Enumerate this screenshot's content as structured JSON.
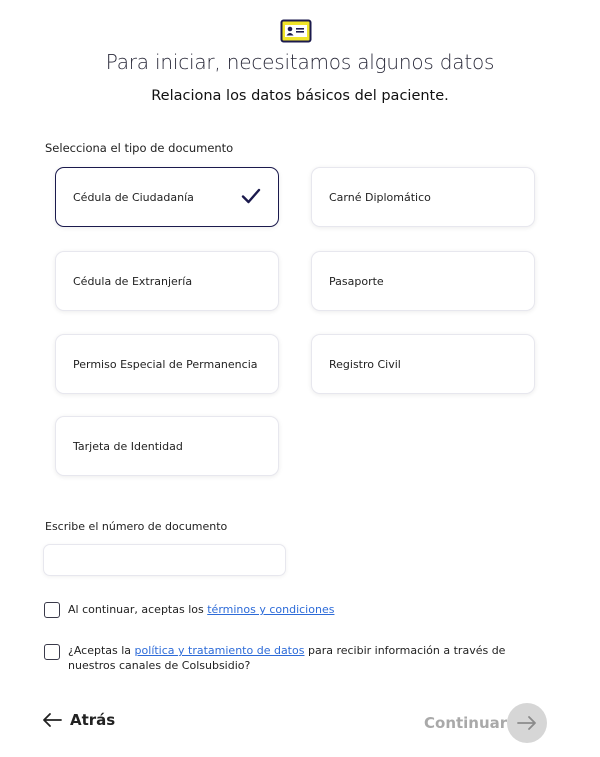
{
  "header": {
    "title": "Para iniciar, necesitamos algunos datos",
    "subtitle": "Relaciona los datos básicos del paciente."
  },
  "document_type": {
    "label": "Selecciona el tipo de documento",
    "selected": "Cédula de Ciudadanía",
    "options": [
      "Cédula de Ciudadanía",
      "Carné Diplomático",
      "Cédula de Extranjería",
      "Pasaporte",
      "Permiso Especial de Permanencia",
      "Registro Civil",
      "Tarjeta de Identidad"
    ]
  },
  "document_number": {
    "label": "Escribe el número de documento",
    "value": ""
  },
  "consents": {
    "terms_prefix": "Al continuar, aceptas los ",
    "terms_link": "términos y condiciones",
    "terms_checked": false,
    "policy_prefix": "¿Aceptas la ",
    "policy_link": "política y tratamiento de datos",
    "policy_suffix": " para recibir información a través de nuestros canales de Colsubsidio?",
    "policy_checked": false
  },
  "footer": {
    "back_label": "Atrás",
    "continue_label": "Continuar"
  },
  "colors": {
    "selected_border": "#1b1a4d",
    "link": "#2d6bd8",
    "disabled": "#a9a9a9",
    "logo_accent": "#f0e42a"
  },
  "icons": [
    "id-card-icon",
    "checkmark-icon",
    "arrow-left-icon",
    "arrow-right-icon"
  ]
}
